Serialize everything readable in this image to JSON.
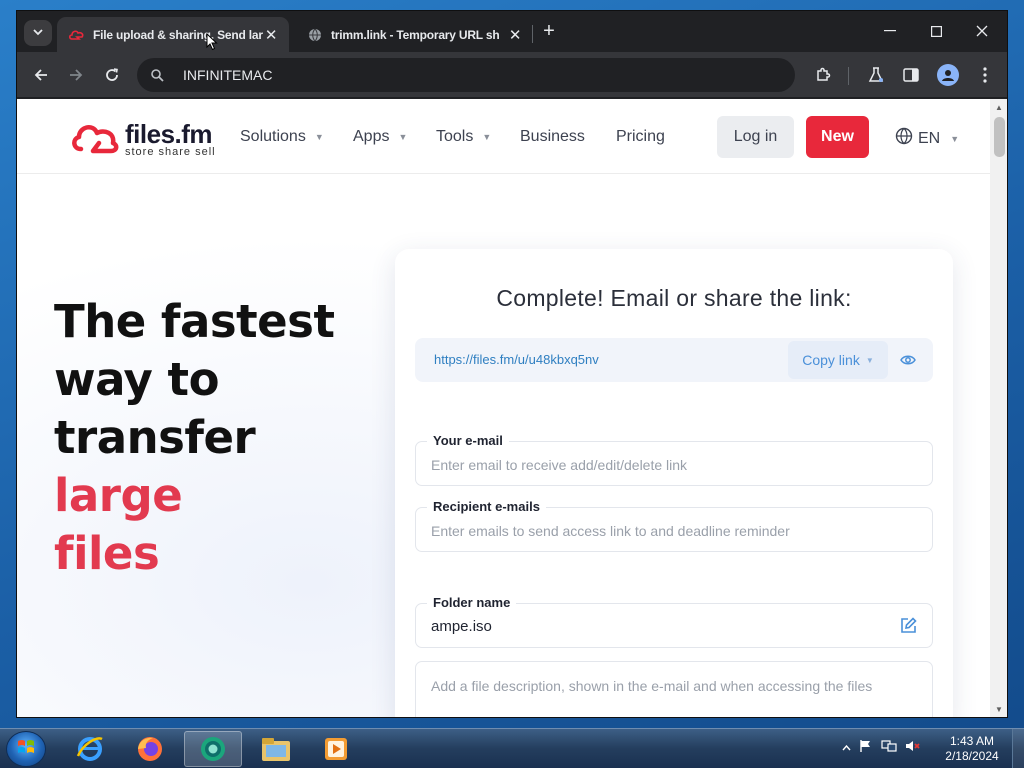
{
  "browser": {
    "tabs": [
      {
        "title": "File upload & sharing. Send lar",
        "active": true
      },
      {
        "title": "trimm.link - Temporary URL sh",
        "active": false
      }
    ],
    "address": "INFINITEMAC",
    "tab_search_icon": "chevron-down-icon",
    "new_tab_label": "+"
  },
  "site": {
    "logo": {
      "name": "files.fm",
      "tagline": "store  share  sell"
    },
    "nav": [
      {
        "label": "Solutions",
        "dropdown": true
      },
      {
        "label": "Apps",
        "dropdown": true
      },
      {
        "label": "Tools",
        "dropdown": true
      },
      {
        "label": "Business",
        "dropdown": false
      },
      {
        "label": "Pricing",
        "dropdown": false
      }
    ],
    "login_label": "Log in",
    "new_label": "New",
    "language": "EN",
    "colors": {
      "brand_red": "#e8283b",
      "accent_text": "#e23a4f",
      "link_blue": "#2f7fc1"
    }
  },
  "hero": {
    "line1": "The fastest",
    "line2": "way to",
    "line3_plain": "transfer ",
    "line3_accent": "large",
    "line4_accent": "files"
  },
  "share_card": {
    "title": "Complete! Email or share the link:",
    "link": "https://files.fm/u/u48kbxq5nv",
    "copy_label": "Copy link",
    "fields": {
      "your_email": {
        "label": "Your e-mail",
        "placeholder": "Enter email to receive add/edit/delete link"
      },
      "recipients": {
        "label": "Recipient e-mails",
        "placeholder": "Enter emails to send access link to and deadline reminder"
      },
      "folder": {
        "label": "Folder name",
        "value": "ampe.iso"
      },
      "description": {
        "placeholder": "Add a file description, shown in the e-mail and when accessing the files"
      }
    }
  },
  "taskbar": {
    "time": "1:43 AM",
    "date": "2/18/2024"
  }
}
